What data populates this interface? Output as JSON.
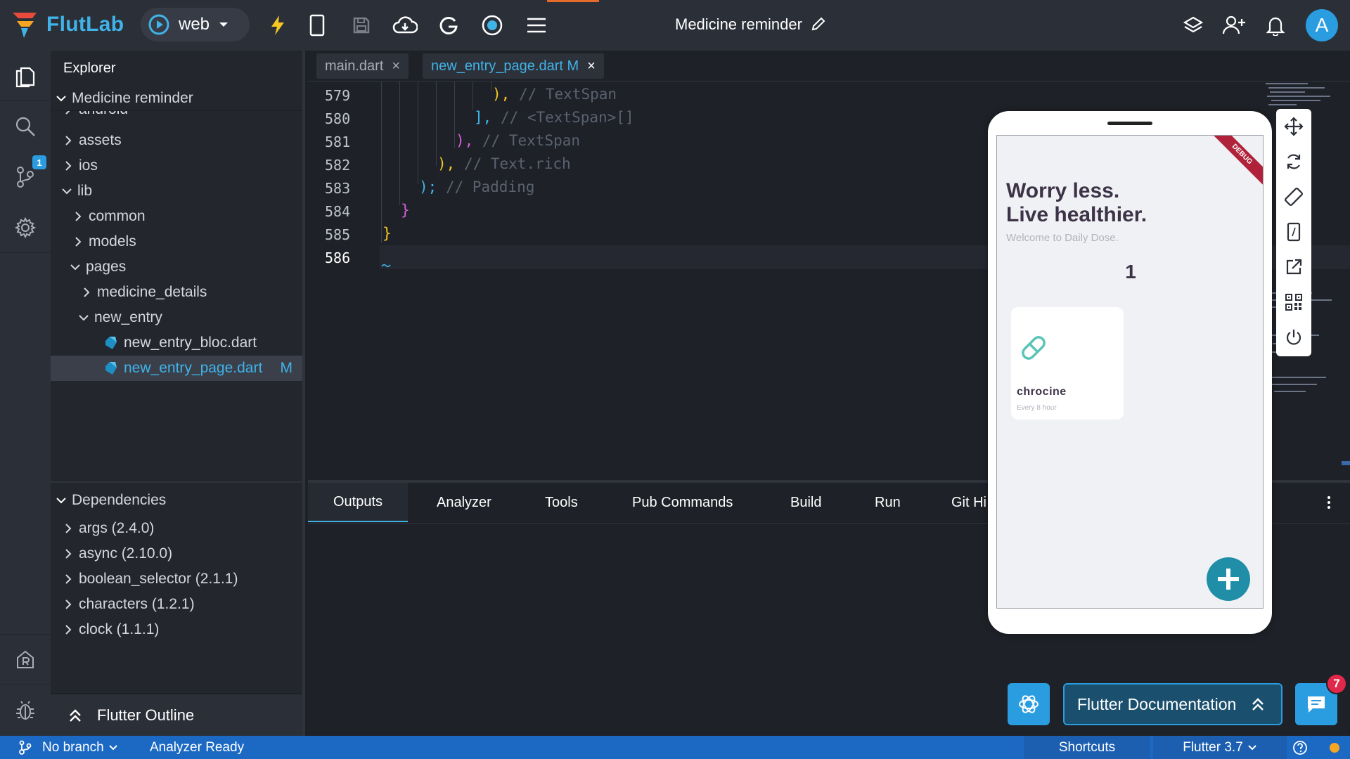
{
  "app": {
    "name": "FlutLab",
    "target": "web",
    "project_title": "Medicine reminder",
    "avatar_letter": "A"
  },
  "explorer": {
    "title": "Explorer",
    "root": "Medicine reminder",
    "items": [
      {
        "label": "android"
      },
      {
        "label": "assets"
      },
      {
        "label": "ios"
      },
      {
        "label": "lib"
      },
      {
        "label": "common"
      },
      {
        "label": "models"
      },
      {
        "label": "pages"
      },
      {
        "label": "medicine_details"
      },
      {
        "label": "new_entry"
      },
      {
        "label": "new_entry_bloc.dart"
      },
      {
        "label": "new_entry_page.dart",
        "flag": "M"
      }
    ],
    "dependencies_title": "Dependencies",
    "dependencies": [
      "args (2.4.0)",
      "async (2.10.0)",
      "boolean_selector (2.1.1)",
      "characters (1.2.1)",
      "clock (1.1.1)"
    ],
    "outline": "Flutter Outline"
  },
  "source_control_badge": "1",
  "tabs": [
    {
      "label": "main.dart",
      "active": false
    },
    {
      "label": "new_entry_page.dart M",
      "active": true
    }
  ],
  "code": {
    "lines": [
      {
        "num": "579",
        "code": "), ",
        "comment": "// TextSpan"
      },
      {
        "num": "580",
        "code": "], ",
        "comment": "// <TextSpan>[]"
      },
      {
        "num": "581",
        "code": "), ",
        "comment": "// TextSpan"
      },
      {
        "num": "582",
        "code": "), ",
        "comment": "// Text.rich"
      },
      {
        "num": "583",
        "code": "); ",
        "comment": "// Padding"
      },
      {
        "num": "584",
        "code": "}",
        "comment": ""
      },
      {
        "num": "585",
        "code": "}",
        "comment": ""
      },
      {
        "num": "586",
        "code": "",
        "comment": ""
      }
    ]
  },
  "panel": {
    "tabs": [
      "Outputs",
      "Analyzer",
      "Tools",
      "Pub Commands",
      "Build",
      "Run",
      "Git Hi"
    ]
  },
  "preview": {
    "debug_banner": "DEBUG",
    "headline_1": "Worry less.",
    "headline_2": "Live healthier.",
    "welcome": "Welcome to Daily Dose.",
    "count": "1",
    "medicine": {
      "name": "chrocine",
      "frequency": "Every 8 hour"
    }
  },
  "buttons": {
    "docs": "Flutter Documentation",
    "chat_badge": "7"
  },
  "status": {
    "branch": "No branch",
    "analyzer": "Analyzer Ready",
    "shortcuts": "Shortcuts",
    "flutter": "Flutter 3.7"
  },
  "colors": {
    "accent": "#40b3e8",
    "status_bar": "#1c69c3",
    "fab": "#1f8ea6",
    "badge": "#e0284a"
  }
}
